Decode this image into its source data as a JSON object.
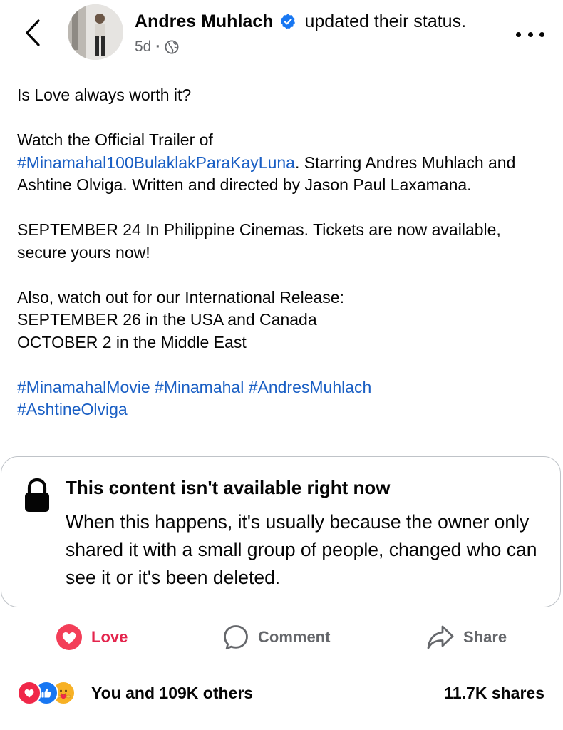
{
  "header": {
    "author_name": "Andres Muhlach",
    "action_text": "updated their status.",
    "time": "5d",
    "separator": "·"
  },
  "post": {
    "paragraphs": [
      {
        "text": "Is Love always worth it?"
      },
      {
        "line1": "Watch the Official Trailer of",
        "hashtag": "#Minamahal100BulaklakParaKayLuna",
        "rest": ". Starring Andres Muhlach and Ashtine Olviga. Written and directed by Jason Paul Laxamana."
      },
      {
        "text": "SEPTEMBER 24 In Philippine Cinemas. Tickets are now available, secure yours now!"
      },
      {
        "line1": "Also, watch out for our International Release:",
        "line2": "SEPTEMBER 26 in the USA and Canada",
        "line3": "OCTOBER 2 in the Middle East"
      }
    ],
    "hashtags": [
      "#MinamahalMovie",
      "#Minamahal",
      "#AndresMuhlach",
      "#AshtineOlviga"
    ]
  },
  "unavailable": {
    "title": "This content isn't available right now",
    "message": "When this happens, it's usually because the owner only shared it with a small group of people, changed who can see it or it's been deleted."
  },
  "actions": {
    "love": "Love",
    "comment": "Comment",
    "share": "Share"
  },
  "footer": {
    "reactions_text": "You and 109K others",
    "shares_text": "11.7K shares"
  },
  "colors": {
    "love": "#e4254d",
    "hashtag": "#1a5fc4",
    "verified": "#1877f2",
    "secondary_text": "#65676b"
  },
  "icons": [
    "back-arrow-icon",
    "verified-badge-icon",
    "globe-icon",
    "more-icon",
    "lock-icon",
    "love-icon",
    "comment-icon",
    "share-icon",
    "love-reaction-icon",
    "like-reaction-icon",
    "care-reaction-icon"
  ]
}
